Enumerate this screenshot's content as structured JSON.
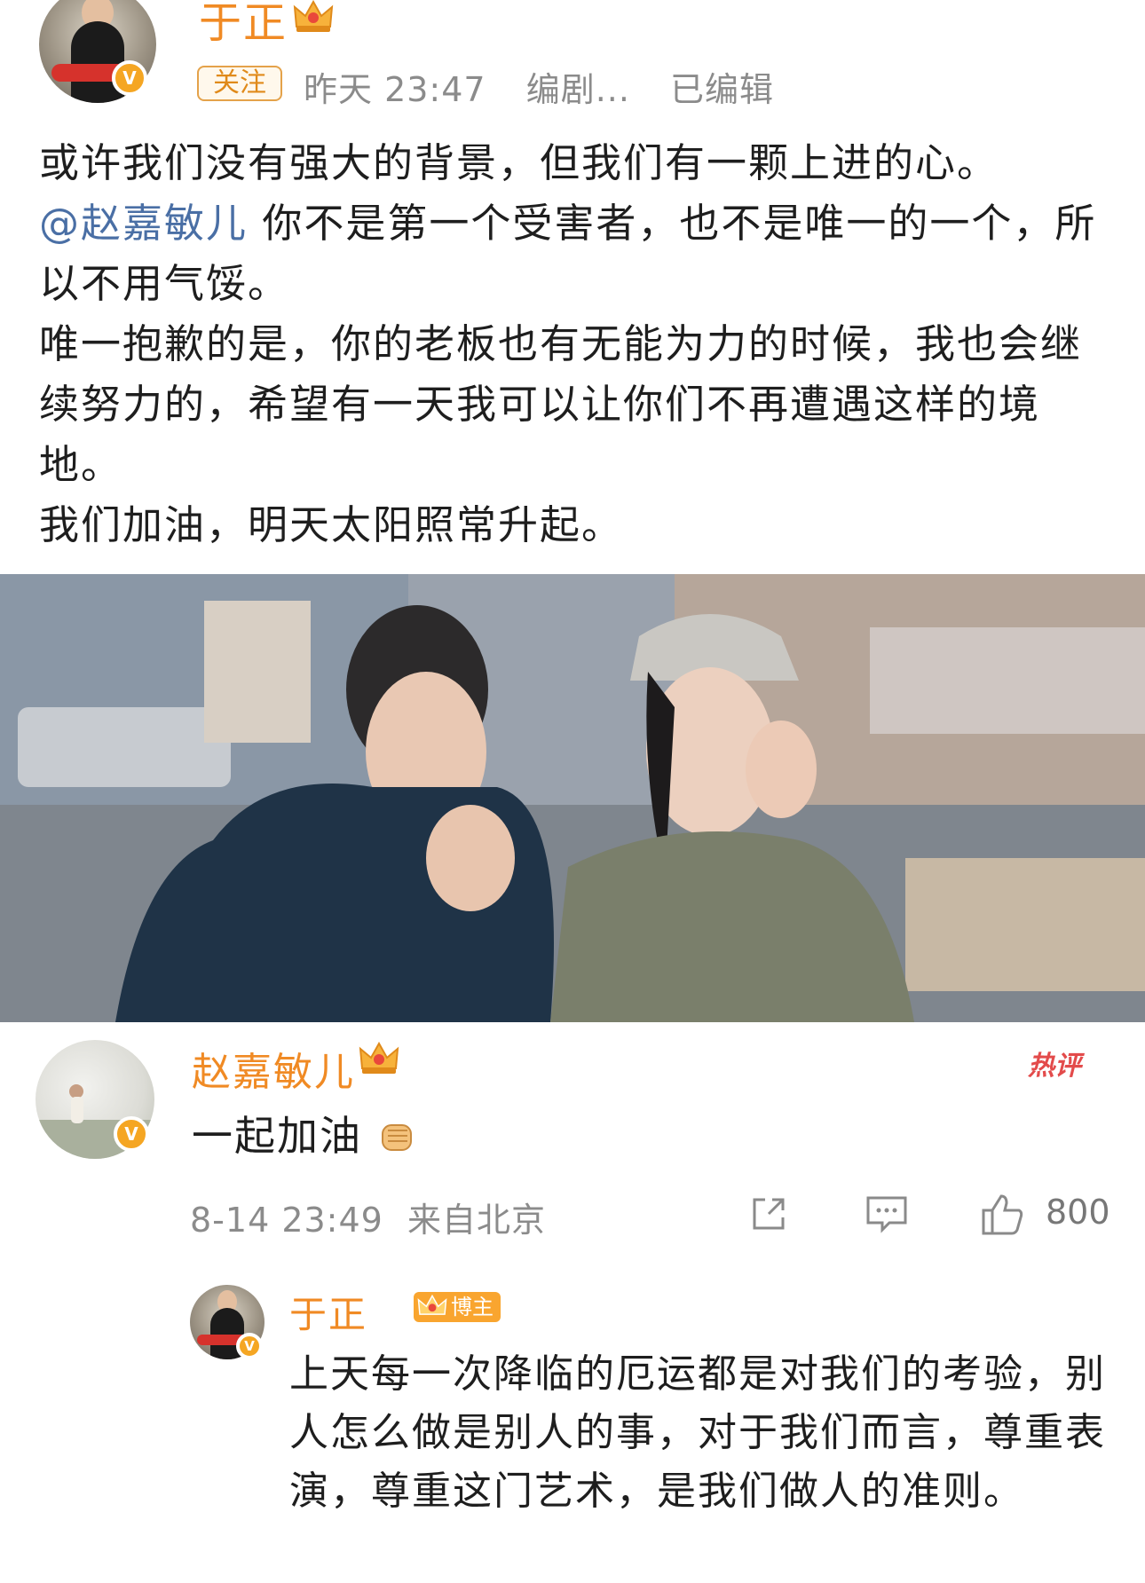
{
  "post": {
    "author": "于正",
    "follow_label": "关注",
    "time": "昨天 23:47",
    "role": "编剧...",
    "edited": "已编辑",
    "paragraphs": {
      "p1": "或许我们没有强大的背景，但我们有一颗上进的心。",
      "p2_mention": "@赵嘉敏儿",
      "p2_text": " 你不是第一个受害者，也不是唯一的一个，所以不用气馁。",
      "p3": "唯一抱歉的是，你的老板也有无能为力的时候，我也会继续努力的，希望有一天我可以让你们不再遭遇这样的境地。",
      "p4": "我们加油，明天太阳照常升起。"
    }
  },
  "comment": {
    "author": "赵嘉敏儿",
    "hot_label": "热评",
    "text": "一起加油",
    "emoji": "fist-emoji",
    "timestamp": "8-14 23:49",
    "location": "来自北京",
    "likes": "800"
  },
  "reply": {
    "author": "于正",
    "badge": "博主",
    "text": "上天每一次降临的厄运都是对我们的考验，别人怎么做是别人的事，对于我们而言，尊重表演，尊重这门艺术，是我们做人的准则。"
  },
  "icons": {
    "verified": "verified-v-icon",
    "crown": "crown-icon",
    "share": "share-icon",
    "comment": "comment-icon",
    "like": "thumbs-up-icon"
  },
  "colors": {
    "username": "#f08a24",
    "mention": "#4a6fa5",
    "meta": "#8b8b8b",
    "hot": "#e34b4b",
    "badge": "#f9a52f"
  }
}
